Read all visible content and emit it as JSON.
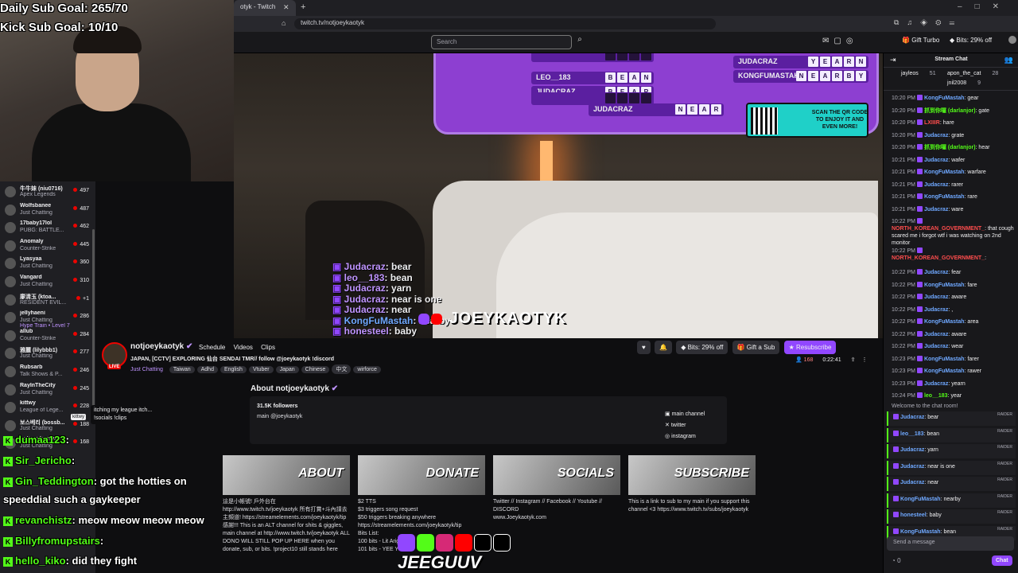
{
  "browser": {
    "tab_title": "otyk - Twitch",
    "url": "twitch.tv/notjoeykaotyk"
  },
  "nav": {
    "search_placeholder": "Search",
    "gift_turbo": "Gift Turbo",
    "bits": "Bits: 29% off"
  },
  "overlay": {
    "goal1": "Daily Sub Goal: 265/70",
    "goal2": "Kick Sub Goal: 10/10"
  },
  "sidebar": {
    "items": [
      {
        "name": "牛牛妹 (niu0716)",
        "cat": "Apex Legends",
        "viewers": "497"
      },
      {
        "name": "Wolfsbanee",
        "cat": "Just Chatting",
        "viewers": "487"
      },
      {
        "name": "17baby17lol",
        "cat": "PUBG: BATTLE...",
        "viewers": "462"
      },
      {
        "name": "Anomaly",
        "cat": "Counter-Strike",
        "viewers": "445"
      },
      {
        "name": "Lyasyaa",
        "cat": "Just Chatting",
        "viewers": "360"
      },
      {
        "name": "Vangard",
        "cat": "Just Chatting",
        "viewers": "310"
      },
      {
        "name": "廖清玉 (ktoa...",
        "cat": "RESIDENT EVIL...",
        "viewers": "+1"
      },
      {
        "name": "jellyhaeni",
        "cat": "Just Chatting",
        "viewers": "286"
      },
      {
        "name": "allub",
        "cat": "Counter-Strike",
        "viewers": "284"
      },
      {
        "name": "雅麗 (lilybbb1)",
        "cat": "Just Chatting",
        "viewers": "277"
      },
      {
        "name": "Rubsarb",
        "cat": "Talk Shows & P...",
        "viewers": "246"
      },
      {
        "name": "RayInTheCity",
        "cat": "Just Chatting",
        "viewers": "245"
      },
      {
        "name": "kittwy",
        "cat": "League of Lege...",
        "viewers": "228"
      },
      {
        "name": "보스베리 (bossb...",
        "cat": "Just Chatting",
        "viewers": "188"
      },
      {
        "name": "notjoeykaotyk",
        "cat": "Just Chatting",
        "viewers": "168"
      }
    ],
    "hype": "Hype Train • Level 7",
    "tooltip": "itching my league itch... !socials !clips",
    "tooltip_user": "kittwy"
  },
  "kick_chat": [
    {
      "user": "dumaa123",
      "text": ":"
    },
    {
      "user": "Sir_Jericho",
      "text": ":"
    },
    {
      "user": "Gin_Teddington",
      "text": ": got the hotties on"
    },
    {
      "user": "",
      "text": "speeddial such a gaykeeper"
    },
    {
      "user": "revanchistz",
      "text": ": meow meow meow meow"
    },
    {
      "user": "Billyfromupstairs",
      "text": ":"
    },
    {
      "user": "hello_kiko",
      "text": ": did they fight"
    }
  ],
  "wordgame": {
    "rows": [
      {
        "name": "LEO__183",
        "word": "BEAN"
      },
      {
        "name": "JUDACRAZ",
        "word": "BEAR"
      },
      {
        "name": "JUDACRAZ",
        "word": "YEARN"
      },
      {
        "name": "KONGFUMASTAH",
        "word": "NEARBY"
      },
      {
        "name": "JUDACRAZ",
        "word": "NEAR"
      }
    ],
    "qr_text": "SCAN THE QR CODE TO ENJOY IT AND EVEN MORE!"
  },
  "video_chat": [
    {
      "user": "Judacraz",
      "text": ": bear"
    },
    {
      "user": "leo__183",
      "text": ": bean"
    },
    {
      "user": "Judacraz",
      "text": ": yarn"
    },
    {
      "user": "Judacraz",
      "text": ": near is one"
    },
    {
      "user": "Judacraz",
      "text": ": near"
    },
    {
      "user": "KongFuMastah",
      "text": ": nearby"
    },
    {
      "user": "honesteel",
      "text": ": baby"
    }
  ],
  "video_logo": "JOEYKAOTYK",
  "channel": {
    "name": "notjoeykaotyk",
    "live": "LIVE",
    "nav": [
      "Schedule",
      "Videos",
      "Clips"
    ],
    "title": "JAPAN, [CCTV] EXPLORING 仙台 SENDAI TMR// follow @joeykaotyk !discord",
    "category": "Just Chatting",
    "tags": [
      "Taiwan",
      "Adhd",
      "English",
      "Vtuber",
      "Japan",
      "Chinese",
      "中文",
      "wirforce"
    ],
    "bits": "Bits: 29% off",
    "gift": "Gift a Sub",
    "resub": "Resubscribe",
    "viewers": "168",
    "uptime": "0:22:41"
  },
  "about": {
    "title": "About notjoeykaotyk",
    "followers": "31.5K followers",
    "desc": "main @joeykaotyk",
    "links": [
      "main channel",
      "twitter",
      "instagram"
    ]
  },
  "panels": [
    {
      "label": "ABOUT",
      "text": "這是小帳號! 戶外台在 http://www.twitch.tv/joeykaotyk 所有打賞+斗內請去主頻道! https://streamelements.com/joeykaotyk/tip 感謝!!! This is an ALT channel for shits & giggles, main channel at http://www.twitch.tv/joeykaotyk ALL DONO WILL STILL POP UP HERE when you donate, sub, or bits. !project10 still stands here"
    },
    {
      "label": "DONATE",
      "text": "$2 TTS\n$3 triggers song request\n$50 triggers breaking anywhere\nhttps://streamelements.com/joeykaotyk/tip\nBits List:\n100 bits - Lit Arigato\n101 bits - YEE YEE"
    },
    {
      "label": "SOCIALS",
      "text": "Twitter // Instagram // Facebook // Youtube // DISCORD\nwww.Joeykaotyk.com"
    },
    {
      "label": "SUBSCRIBE",
      "text": "This is a link to sub to my main if you support this channel <3 https://www.twitch.tv/subs/joeykaotyk"
    }
  ],
  "brand_text": "JEEGUUV",
  "chat": {
    "header": "Stream Chat",
    "gifters": [
      {
        "name": "jayleos",
        "count": "51"
      },
      {
        "name": "apon_the_cat",
        "count": "28"
      },
      {
        "name": "jnil2008",
        "count": "9"
      }
    ],
    "messages": [
      {
        "t": "10:20 PM",
        "u": "KongFuMastah",
        "c": "#6fa8ff",
        "m": "gear"
      },
      {
        "t": "10:20 PM",
        "u": "抓到你囉 (darlanjor)",
        "c": "#53fc18",
        "m": "gate"
      },
      {
        "t": "10:20 PM",
        "u": "LXIIIR",
        "c": "#ff4d4d",
        "m": "hare"
      },
      {
        "t": "10:20 PM",
        "u": "Judacraz",
        "c": "#6fa8ff",
        "m": "grate"
      },
      {
        "t": "10:20 PM",
        "u": "抓到你囉 (darlanjor)",
        "c": "#53fc18",
        "m": "hear"
      },
      {
        "t": "10:21 PM",
        "u": "Judacraz",
        "c": "#6fa8ff",
        "m": "wafer"
      },
      {
        "t": "10:21 PM",
        "u": "KongFuMastah",
        "c": "#6fa8ff",
        "m": "warfare"
      },
      {
        "t": "10:21 PM",
        "u": "Judacraz",
        "c": "#6fa8ff",
        "m": "rarer"
      },
      {
        "t": "10:21 PM",
        "u": "KongFuMastah",
        "c": "#6fa8ff",
        "m": "rare"
      },
      {
        "t": "10:21 PM",
        "u": "Judacraz",
        "c": "#6fa8ff",
        "m": "ware"
      },
      {
        "t": "10:22 PM",
        "u": "NORTH_KOREAN_GOVERNMENT_",
        "c": "#ff4d4d",
        "m": "that cough scared me i forgot wtf i was watching on 2nd monitor"
      },
      {
        "t": "10:22 PM",
        "u": "NORTH_KOREAN_GOVERNMENT_",
        "c": "#ff4d4d",
        "m": ""
      },
      {
        "t": "10:22 PM",
        "u": "Judacraz",
        "c": "#6fa8ff",
        "m": "fear"
      },
      {
        "t": "10:22 PM",
        "u": "KongFuMastah",
        "c": "#6fa8ff",
        "m": "fare"
      },
      {
        "t": "10:22 PM",
        "u": "Judacraz",
        "c": "#6fa8ff",
        "m": "aware"
      },
      {
        "t": "10:22 PM",
        "u": "Judacraz",
        "c": "#6fa8ff",
        "m": ","
      },
      {
        "t": "10:22 PM",
        "u": "KongFuMastah",
        "c": "#6fa8ff",
        "m": "area"
      },
      {
        "t": "10:22 PM",
        "u": "Judacraz",
        "c": "#6fa8ff",
        "m": "aware"
      },
      {
        "t": "10:22 PM",
        "u": "Judacraz",
        "c": "#6fa8ff",
        "m": "wear"
      },
      {
        "t": "10:23 PM",
        "u": "KongFuMastah",
        "c": "#6fa8ff",
        "m": "farer"
      },
      {
        "t": "10:23 PM",
        "u": "KongFuMastah",
        "c": "#6fa8ff",
        "m": "rawer"
      },
      {
        "t": "10:23 PM",
        "u": "Judacraz",
        "c": "#6fa8ff",
        "m": "yearn"
      },
      {
        "t": "10:24 PM",
        "u": "leo__183",
        "c": "#53fc18",
        "m": "year"
      }
    ],
    "welcome": "Welcome to the chat room!",
    "raid_label": "RAIDER",
    "raid_messages": [
      {
        "u": "Judacraz",
        "m": "bear"
      },
      {
        "u": "leo__183",
        "m": "bean"
      },
      {
        "u": "Judacraz",
        "m": "yarn"
      },
      {
        "u": "Judacraz",
        "m": "near is one"
      },
      {
        "u": "Judacraz",
        "m": "near"
      },
      {
        "u": "KongFuMastah",
        "m": "nearby"
      },
      {
        "u": "honesteel",
        "m": "baby"
      },
      {
        "u": "KongFuMastah",
        "m": "bean"
      }
    ],
    "input_placeholder": "Send a message",
    "points": "0",
    "send": "Chat"
  }
}
